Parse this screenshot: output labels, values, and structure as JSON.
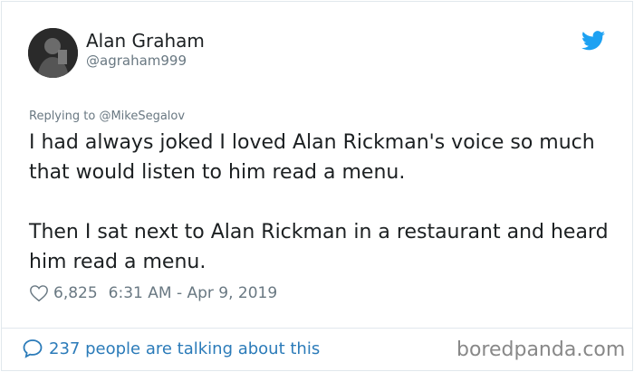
{
  "author": {
    "display_name": "Alan Graham",
    "handle": "@agraham999"
  },
  "reply": {
    "prefix": "Replying to",
    "mention": "@MikeSegalov"
  },
  "tweet": {
    "paragraph_1": "I had always joked I loved Alan Rickman's voice so much that would listen to him read a menu.",
    "paragraph_2": "Then I sat next to Alan Rickman in a restaurant and heard him read a menu."
  },
  "meta": {
    "likes": "6,825",
    "timestamp": "6:31 AM - Apr 9, 2019"
  },
  "footer": {
    "talking": "237 people are talking about this"
  },
  "watermark": "boredpanda.com",
  "colors": {
    "twitter_blue": "#1da1f2",
    "link_blue": "#2b7bb9",
    "secondary_text": "#697882",
    "primary_text": "#1c2022"
  },
  "icons": {
    "brand": "twitter-bird-icon",
    "like": "heart-icon",
    "conversation": "speech-bubble-icon"
  }
}
